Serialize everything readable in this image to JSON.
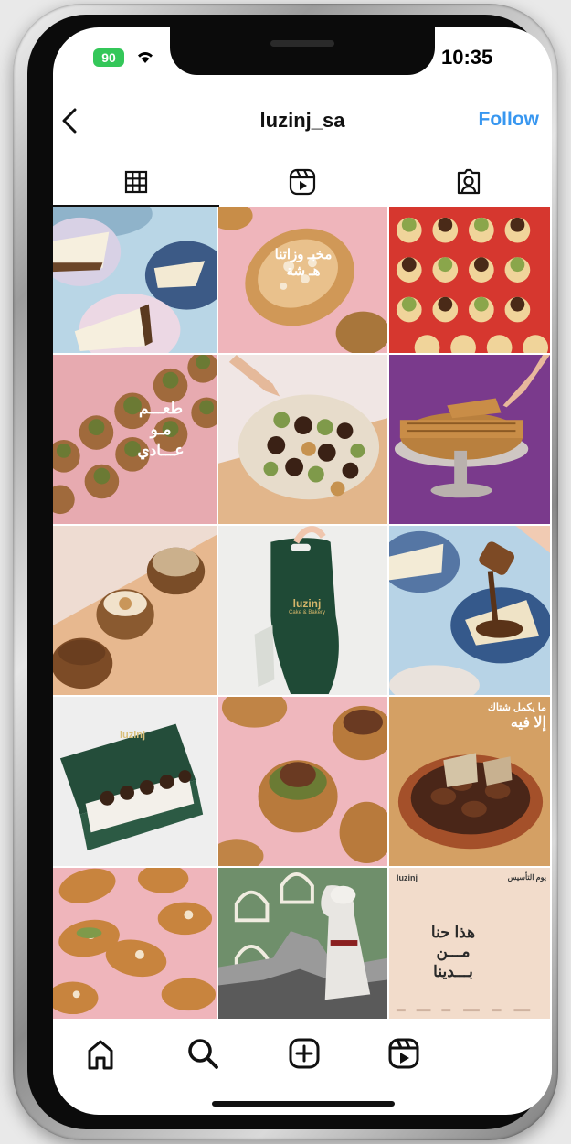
{
  "status_bar": {
    "battery_label": "90",
    "time": "10:35"
  },
  "header": {
    "username": "luzinj_sa",
    "follow_label": "Follow"
  },
  "tabs": [
    {
      "name": "grid",
      "icon": "grid-icon",
      "active": true
    },
    {
      "name": "reels",
      "icon": "reels-icon",
      "active": false
    },
    {
      "name": "tagged",
      "icon": "tagged-icon",
      "active": false
    }
  ],
  "posts": [
    {
      "subject": "cheesecake-slices-on-blue-plates"
    },
    {
      "subject": "almond-croissant",
      "overlay_lines": [
        "مخبـ   وزاتنا",
        "هـ      شة"
      ]
    },
    {
      "subject": "mini-cakes-on-red"
    },
    {
      "subject": "pistachio-cakes",
      "overlay_lines": [
        "طعـــم",
        "مـو",
        "عـــادي"
      ]
    },
    {
      "subject": "chocolate-bites-plate"
    },
    {
      "subject": "pie-on-stand-purple"
    },
    {
      "subject": "cinnamon-rolls-peach"
    },
    {
      "subject": "green-luzinj-bag",
      "bag_brand": "luzinj",
      "bag_subtitle": "Cake & Bakery"
    },
    {
      "subject": "cheesecake-chocolate-pour"
    },
    {
      "subject": "green-luzinj-box",
      "box_brand": "luzinj"
    },
    {
      "subject": "pistachio-cream-cakes"
    },
    {
      "subject": "chocolate-bowl-promo",
      "overlay_lines": [
        "ما يكمل شتاك",
        "إلا فيه"
      ]
    },
    {
      "subject": "croissants-on-pink"
    },
    {
      "subject": "saudi-heritage-collage"
    },
    {
      "subject": "founding-day-post",
      "brand": "luzinj",
      "partner": "يوم التأسيس",
      "text_lines": [
        "هذا حنا",
        "مـــن",
        "بـــدينا"
      ]
    }
  ],
  "bottom_nav": [
    {
      "name": "home",
      "icon": "home-icon"
    },
    {
      "name": "search",
      "icon": "search-icon"
    },
    {
      "name": "new-post",
      "icon": "plus-square-icon"
    },
    {
      "name": "reels",
      "icon": "reels-icon"
    }
  ],
  "colors": {
    "follow_blue": "#3897f0",
    "battery_green": "#34c759",
    "brand_green": "#1f4a36"
  }
}
